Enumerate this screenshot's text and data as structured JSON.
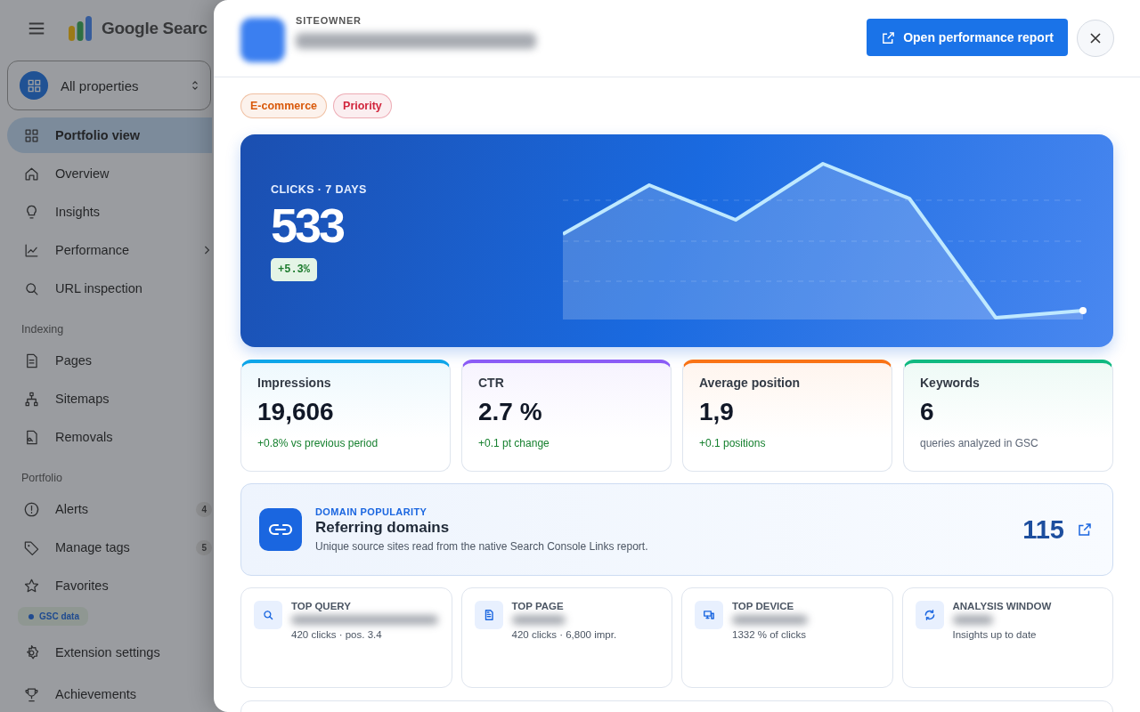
{
  "sidebar": {
    "product_title": "Google Searc",
    "property_selector": {
      "label": "All properties"
    },
    "sections": [
      {
        "items": [
          {
            "label": "Portfolio view",
            "selected": true
          },
          {
            "label": "Overview",
            "selected": false
          },
          {
            "label": "Insights",
            "selected": false
          },
          {
            "label": "Performance",
            "selected": false,
            "kind": "submenu"
          },
          {
            "label": "URL inspection",
            "selected": false
          }
        ]
      },
      {
        "heading": "Indexing",
        "items": [
          {
            "label": "Pages",
            "selected": false
          },
          {
            "label": "Sitemaps",
            "selected": false
          },
          {
            "label": "Removals",
            "selected": false
          }
        ]
      },
      {
        "heading": "Portfolio",
        "items": [
          {
            "label": "Alerts",
            "selected": false,
            "badge": "4"
          },
          {
            "label": "Manage tags",
            "selected": false,
            "badge": "5"
          },
          {
            "label": "Favorites",
            "selected": false
          }
        ]
      }
    ],
    "data_chip": "GSC data",
    "footer_items": [
      {
        "label": "Extension settings",
        "selected": false
      },
      {
        "label": "Achievements",
        "selected": false
      }
    ]
  },
  "drawer": {
    "eyebrow": "SITEOWNER",
    "open_button": "Open performance report",
    "tags": [
      {
        "label": "E-commerce",
        "color": "#d9590b"
      },
      {
        "label": "Priority",
        "color": "#d1253c"
      }
    ],
    "hero": {
      "label": "CLICKS · 7 DAYS",
      "value": "533",
      "change": "+5.3%"
    },
    "metrics": [
      {
        "label": "Impressions",
        "value": "19,606",
        "note": "+0.8% vs previous period",
        "kind": "delta",
        "color": "#0ea5e9"
      },
      {
        "label": "CTR",
        "value": "2.7 %",
        "note": "+0.1 pt change",
        "kind": "delta",
        "color": "#8b5cf6"
      },
      {
        "label": "Average position",
        "value": "1,9",
        "note": "+0.1 positions",
        "kind": "delta",
        "color": "#f97316"
      },
      {
        "label": "Keywords",
        "value": "6",
        "note": "queries analyzed in GSC",
        "kind": "info",
        "color": "#10b981"
      }
    ],
    "domain_popularity": {
      "eyebrow": "DOMAIN POPULARITY",
      "title": "Referring domains",
      "description": "Unique source sites read from the native Search Console Links report.",
      "value": "115"
    },
    "insights": [
      {
        "label": "TOP QUERY",
        "detail": "420 clicks · pos. 3.4"
      },
      {
        "label": "TOP PAGE",
        "detail": "420 clicks · 6,800 impr."
      },
      {
        "label": "TOP DEVICE",
        "detail": "1332 % of clicks"
      },
      {
        "label": "ANALYSIS WINDOW",
        "detail": "Insights up to date"
      }
    ]
  }
}
